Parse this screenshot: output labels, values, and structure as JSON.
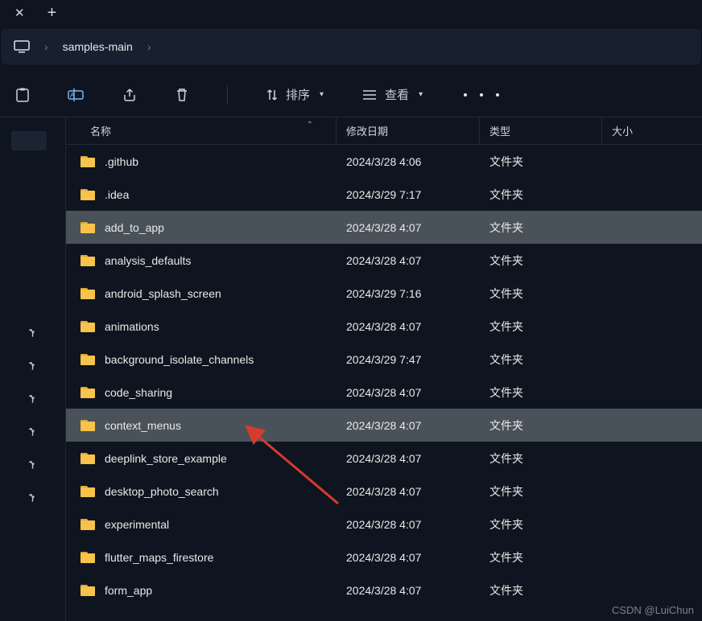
{
  "tabbar": {
    "close": "✕",
    "plus": "+"
  },
  "crumb": {
    "sep": "›",
    "root": "samples-main"
  },
  "toolbar": {
    "sort": "排序",
    "view": "查看"
  },
  "columns": {
    "name": "名称",
    "date": "修改日期",
    "type": "类型",
    "size": "大小"
  },
  "rows": [
    {
      "name": ".github",
      "date": "2024/3/28 4:06",
      "type": "文件夹",
      "selected": false
    },
    {
      "name": ".idea",
      "date": "2024/3/29 7:17",
      "type": "文件夹",
      "selected": false
    },
    {
      "name": "add_to_app",
      "date": "2024/3/28 4:07",
      "type": "文件夹",
      "selected": true
    },
    {
      "name": "analysis_defaults",
      "date": "2024/3/28 4:07",
      "type": "文件夹",
      "selected": false
    },
    {
      "name": "android_splash_screen",
      "date": "2024/3/29 7:16",
      "type": "文件夹",
      "selected": false
    },
    {
      "name": "animations",
      "date": "2024/3/28 4:07",
      "type": "文件夹",
      "selected": false
    },
    {
      "name": "background_isolate_channels",
      "date": "2024/3/29 7:47",
      "type": "文件夹",
      "selected": false
    },
    {
      "name": "code_sharing",
      "date": "2024/3/28 4:07",
      "type": "文件夹",
      "selected": false
    },
    {
      "name": "context_menus",
      "date": "2024/3/28 4:07",
      "type": "文件夹",
      "selected": true
    },
    {
      "name": "deeplink_store_example",
      "date": "2024/3/28 4:07",
      "type": "文件夹",
      "selected": false
    },
    {
      "name": "desktop_photo_search",
      "date": "2024/3/28 4:07",
      "type": "文件夹",
      "selected": false
    },
    {
      "name": "experimental",
      "date": "2024/3/28 4:07",
      "type": "文件夹",
      "selected": false
    },
    {
      "name": "flutter_maps_firestore",
      "date": "2024/3/28 4:07",
      "type": "文件夹",
      "selected": false
    },
    {
      "name": "form_app",
      "date": "2024/3/28 4:07",
      "type": "文件夹",
      "selected": false
    }
  ],
  "watermark": "CSDN @LuiChun"
}
